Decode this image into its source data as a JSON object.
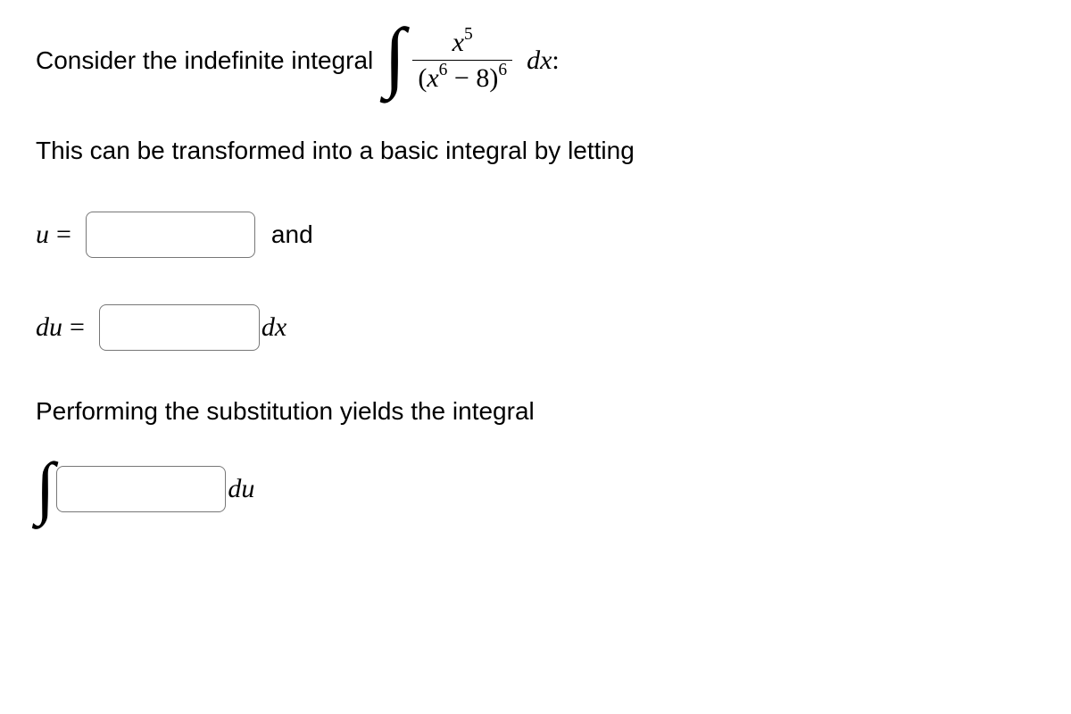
{
  "line1_prefix": "Consider the indefinite integral",
  "integral": {
    "numerator_var": "x",
    "numerator_exp": "5",
    "denom_open": "(",
    "denom_var": "x",
    "denom_exp_inner": "6",
    "denom_minus": " − ",
    "denom_const": "8",
    "denom_close": ")",
    "denom_exp_outer": "6",
    "dx": "dx",
    "colon": ":"
  },
  "line_transform": "This can be transformed into a basic integral by letting",
  "labels": {
    "u": "u",
    "eq": "=",
    "and": "and",
    "du": "du",
    "dx": "dx"
  },
  "perform_line": "Performing the substitution yields the integral",
  "final": {
    "du": "du"
  }
}
